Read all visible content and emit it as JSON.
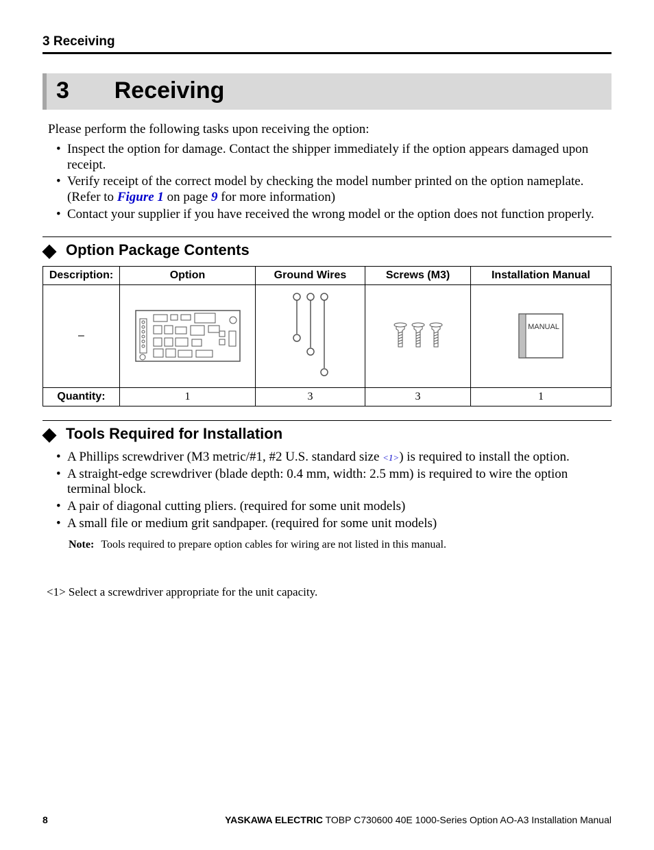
{
  "running_head": "3  Receiving",
  "chapter": {
    "num": "3",
    "title": "Receiving"
  },
  "intro": "Please perform the following tasks upon receiving the option:",
  "bullets1": [
    "Inspect the option for damage. Contact the shipper immediately if the option appears damaged upon receipt.",
    {
      "pre": "Verify receipt of the correct model by checking the model number printed on the option nameplate. (Refer to ",
      "ref": "Figure 1",
      "mid": " on page ",
      "page": "9",
      "post": " for more information)"
    },
    "Contact your supplier if you have received the wrong model or the option does not function properly."
  ],
  "section_pkg": "Option Package Contents",
  "table": {
    "headers": {
      "desc": "Description:",
      "option": "Option",
      "ground": "Ground Wires",
      "screws": "Screws (M3)",
      "manual": "Installation Manual"
    },
    "qty_label": "Quantity:",
    "qty": {
      "option": "1",
      "ground": "3",
      "screws": "3",
      "manual": "1"
    },
    "manual_label": "MANUAL"
  },
  "section_tools": "Tools Required for Installation",
  "bullets2": [
    {
      "pre": "A Phillips screwdriver (M3 metric/#1, #2 U.S. standard size ",
      "sup": "<1>",
      "post": ") is required to install the option."
    },
    "A straight-edge screwdriver (blade depth: 0.4 mm, width: 2.5 mm) is required to wire the option terminal block.",
    "A pair of diagonal cutting pliers. (required for some unit models)",
    "A small file or medium grit sandpaper. (required for some unit models)"
  ],
  "note": {
    "label": "Note:",
    "text": "Tools required to prepare option cables for wiring are not listed in this manual."
  },
  "footnote": "<1> Select a screwdriver appropriate for the unit capacity.",
  "footer": {
    "page": "8",
    "company": "YASKAWA ELECTRIC",
    "doc": " TOBP C730600 40E 1000-Series Option AO-A3 Installation Manual"
  }
}
